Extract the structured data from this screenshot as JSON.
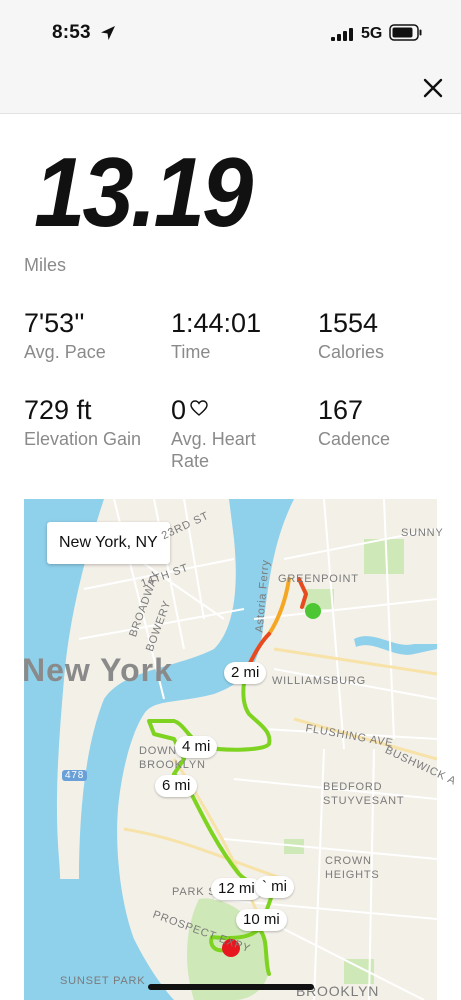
{
  "status": {
    "time": "8:53",
    "network": "5G"
  },
  "summary": {
    "distance": "13.19",
    "distance_unit": "Miles"
  },
  "stats": [
    {
      "value": "7'53''",
      "label": "Avg. Pace"
    },
    {
      "value": "1:44:01",
      "label": "Time"
    },
    {
      "value": "1554",
      "label": "Calories"
    },
    {
      "value": "729 ft",
      "label": "Elevation Gain"
    },
    {
      "value": "0",
      "label": "Avg. Heart Rate"
    },
    {
      "value": "167",
      "label": "Cadence"
    }
  ],
  "map": {
    "location_label": "New York, NY",
    "city_label": "New York",
    "mile_markers": [
      "2 mi",
      "4 mi",
      "6 mi",
      "12 mi",
      "` mi",
      "10 mi"
    ],
    "places": [
      "GREENPOINT",
      "WILLIAMSBURG",
      "FLUSHING AVE",
      "BEDFORD STUYVESANT",
      "CROWN HEIGHTS",
      "PARK SLOPE",
      "PROSPECT EXPY",
      "SUNSET PARK",
      "BROOKLYN",
      "DOWNTOWN BROOKLYN",
      "BROADWAY",
      "BOWERY",
      "23RD ST",
      "14TH ST",
      "Astoria Ferry",
      "SUNNY",
      "BUSHWICK A",
      "478"
    ],
    "colors": {
      "water": "#8fd0ea",
      "park": "#cfe8b8",
      "route_good": "#7ed321",
      "route_mid": "#f5a623",
      "route_slow": "#e84a1f",
      "start_dot": "#4cc733",
      "end_dot": "#e8161f"
    }
  }
}
